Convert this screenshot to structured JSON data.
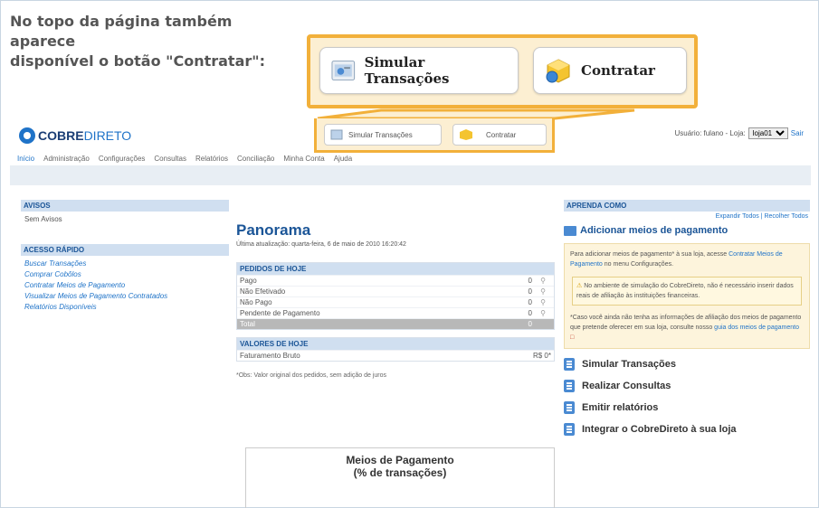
{
  "caption": {
    "line1": "No topo da página também aparece",
    "line2": "disponível o botão \"Contratar\":"
  },
  "callout": {
    "simular_label": "Simular Transações",
    "contratar_label": "Contratar"
  },
  "header": {
    "logo_part1": "COBRE",
    "logo_part2": "DIRETO",
    "small_simular_label": "Simular Transações",
    "small_contratar_label": "Contratar",
    "user_text": "Usuário: fulano - Loja:",
    "store_selected": "loja01",
    "exit_label": "Sair"
  },
  "menu": {
    "items": [
      "Início",
      "Administração",
      "Configurações",
      "Consultas",
      "Relatórios",
      "Conciliação",
      "Minha Conta",
      "Ajuda"
    ]
  },
  "left": {
    "avisos_title": "AVISOS",
    "avisos_body": "Sem Avisos",
    "acesso_title": "ACESSO RÁPIDO",
    "links": [
      "Buscar Transações",
      "Comprar Cobôlos",
      "Contratar Meios de Pagamento",
      "Visualizar Meios de Pagamento Contratados",
      "Relatórios Disponíveis"
    ]
  },
  "center": {
    "title": "Panorama",
    "subtitle": "Última atualização: quarta-feira, 6 de maio de 2010 16:20:42",
    "pedidos_title": "PEDIDOS DE HOJE",
    "pedidos": [
      {
        "label": "Pago",
        "value": "0"
      },
      {
        "label": "Não Efetivado",
        "value": "0"
      },
      {
        "label": "Não Pago",
        "value": "0"
      },
      {
        "label": "Pendente de Pagamento",
        "value": "0"
      }
    ],
    "total_label": "Total",
    "total_value": "0",
    "valores_title": "VALORES DE HOJE",
    "faturamento_label": "Faturamento Bruto",
    "faturamento_value": "R$ 0*",
    "obs": "*Obs: Valor original dos pedidos, sem adição de juros",
    "chart_title1": "Meios de Pagamento",
    "chart_title2": "(% de transações)"
  },
  "right": {
    "aprenda_title": "APRENDA COMO",
    "expand_label": "Expandir Todos",
    "collapse_label": "Recolher Todos",
    "add_title": "Adicionar meios de pagamento",
    "add_body": "Para adicionar meios de pagamento* à sua loja, acesse",
    "add_link": "Contratar Meios de Pagamento",
    "add_body2": "no menu Configurações.",
    "warn_text": "No ambiente de simulação do CobreDireto, não é necessário inserir dados reais de afiliação às instituições financeiras.",
    "note_text": "*Caso você ainda não tenha as informações de afiliação dos meios de pagamento que pretende oferecer em sua loja, consulte nosso",
    "note_link": "guia dos meios de pagamento",
    "learn_items": [
      "Simular Transações",
      "Realizar Consultas",
      "Emitir relatórios",
      "Integrar o CobreDireto à sua loja"
    ]
  }
}
